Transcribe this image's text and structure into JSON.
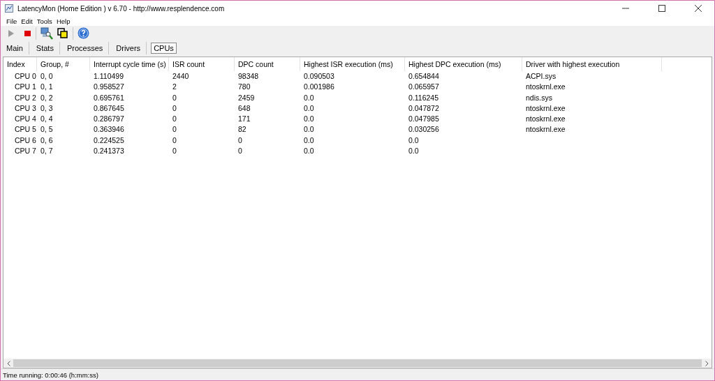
{
  "window": {
    "title": "LatencyMon  (Home Edition )  v 6.70 - http://www.resplendence.com"
  },
  "menu": [
    "File",
    "Edit",
    "Tools",
    "Help"
  ],
  "tabs": [
    {
      "label": "Main",
      "selected": false
    },
    {
      "label": "Stats",
      "selected": false
    },
    {
      "label": "Processes",
      "selected": false
    },
    {
      "label": "Drivers",
      "selected": false
    },
    {
      "label": "CPUs",
      "selected": true
    }
  ],
  "table": {
    "columns": [
      "Index",
      "Group, #",
      "Interrupt cycle time (s)",
      "ISR count",
      "DPC count",
      "Highest ISR execution (ms)",
      "Highest DPC execution (ms)",
      "Driver with highest execution"
    ],
    "rows": [
      [
        "CPU 0",
        "0, 0",
        "1.110499",
        "2440",
        "98348",
        "0.090503",
        "0.654844",
        "ACPI.sys"
      ],
      [
        "CPU 1",
        "0, 1",
        "0.958527",
        "2",
        "780",
        "0.001986",
        "0.065957",
        "ntoskrnl.exe"
      ],
      [
        "CPU 2",
        "0, 2",
        "0.695761",
        "0",
        "2459",
        "0.0",
        "0.116245",
        "ndis.sys"
      ],
      [
        "CPU 3",
        "0, 3",
        "0.867645",
        "0",
        "648",
        "0.0",
        "0.047872",
        "ntoskrnl.exe"
      ],
      [
        "CPU 4",
        "0, 4",
        "0.286797",
        "0",
        "171",
        "0.0",
        "0.047985",
        "ntoskrnl.exe"
      ],
      [
        "CPU 5",
        "0, 5",
        "0.363946",
        "0",
        "82",
        "0.0",
        "0.030256",
        "ntoskrnl.exe"
      ],
      [
        "CPU 6",
        "0, 6",
        "0.224525",
        "0",
        "0",
        "0.0",
        "0.0",
        ""
      ],
      [
        "CPU 7",
        "0, 7",
        "0.241373",
        "0",
        "0",
        "0.0",
        "0.0",
        ""
      ]
    ]
  },
  "status_bar": "Time running: 0:00:46  (h:mm:ss)"
}
